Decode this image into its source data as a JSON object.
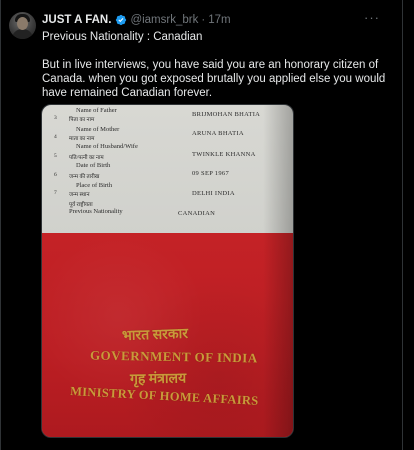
{
  "tweet": {
    "author_name": "JUST A FAN.",
    "handle": "@iamsrk_brk",
    "time": "17m",
    "more_glyph": "···",
    "line1": "Previous Nationality : Canadian",
    "line2": "But in live interviews, you have said you are an honorary citizen of Canada. when you got exposed brutally you applied else you would have remained Canadian forever.",
    "verified_color": "#1d9bf0"
  },
  "document": {
    "rows": [
      {
        "num": "3",
        "label": "Name of Father",
        "hindi": "पिता का नाम",
        "value": "BRIJMOHAN BHATIA"
      },
      {
        "num": "4",
        "label": "Name of Mother",
        "hindi": "माता का नाम",
        "value": "ARUNA BHATIA"
      },
      {
        "num": "5",
        "label": "Name of Husband/Wife",
        "hindi": "पति/पत्नी का नाम",
        "value": "TWINKLE KHANNA"
      },
      {
        "num": "6",
        "label": "Date of Birth",
        "hindi": "जन्म की तारीख",
        "value": "09 SEP 1967"
      },
      {
        "num": "7",
        "label": "Place of Birth",
        "hindi": "जन्म स्थान",
        "value": "DELHI INDIA"
      },
      {
        "num": "",
        "label": "Previous Nationality",
        "hindi": "पूर्व राष्ट्रीयता",
        "value": "CANADIAN"
      }
    ],
    "cover_hindi_1": "भारत सरकार",
    "cover_english_1": "GOVERNMENT OF INDIA",
    "cover_hindi_2": "गृह मंत्रालय",
    "cover_english_2": "MINISTRY OF HOME AFFAIRS"
  }
}
